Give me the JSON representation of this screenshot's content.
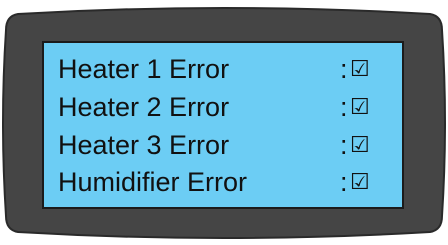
{
  "display": {
    "rows": [
      {
        "label": "Heater 1 Error",
        "separator": ":",
        "status_glyph": "☑",
        "status_icon": "checked-box-icon"
      },
      {
        "label": "Heater 2 Error",
        "separator": ":",
        "status_glyph": "☑",
        "status_icon": "checked-box-icon"
      },
      {
        "label": "Heater 3 Error",
        "separator": ":",
        "status_glyph": "☑",
        "status_icon": "checked-box-icon"
      },
      {
        "label": "Humidifier Error",
        "separator": ":",
        "status_glyph": "☑",
        "status_icon": "checked-box-icon"
      }
    ]
  },
  "colors": {
    "screen": "#6ccdf4",
    "bezel": "#454545",
    "text": "#111111"
  }
}
